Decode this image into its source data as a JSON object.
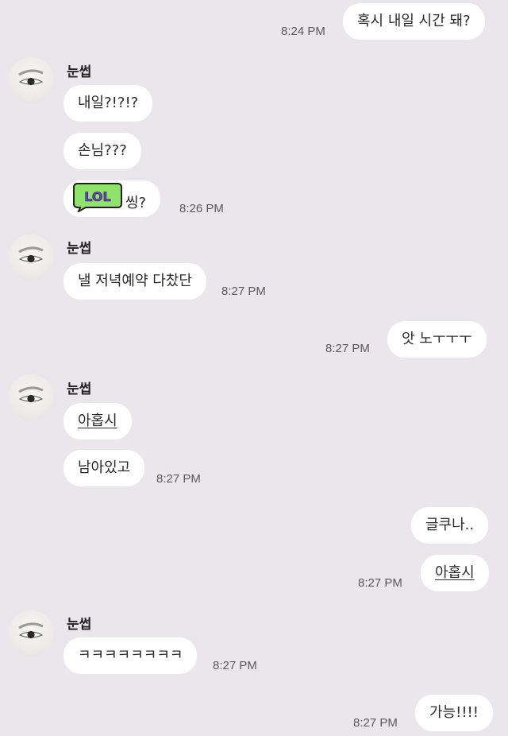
{
  "sender_name": "눈썹",
  "messages": {
    "m1": {
      "text": "혹시 내일 시간 돼?",
      "time": "8:24 PM"
    },
    "m2": {
      "text": "내일?!?!?"
    },
    "m3": {
      "text": "손님???"
    },
    "m4": {
      "text": "씽?",
      "sticker_text": "LOL",
      "time": "8:26 PM"
    },
    "m5": {
      "text": "낼 저녁예약 다찼단",
      "time": "8:27 PM"
    },
    "m6": {
      "text": "앗 노ㅜㅜㅜ",
      "time": "8:27 PM"
    },
    "m7": {
      "text": "아홉시"
    },
    "m8": {
      "text": "남아있고",
      "time": "8:27 PM"
    },
    "m9": {
      "text": "글쿠나.."
    },
    "m10": {
      "text": "아홉시",
      "time": "8:27 PM"
    },
    "m11": {
      "text": "ㅋㅋㅋㅋㅋㅋㅋㅋ",
      "time": "8:27 PM"
    },
    "m12": {
      "text": "가능!!!!",
      "time": "8:27 PM"
    }
  }
}
